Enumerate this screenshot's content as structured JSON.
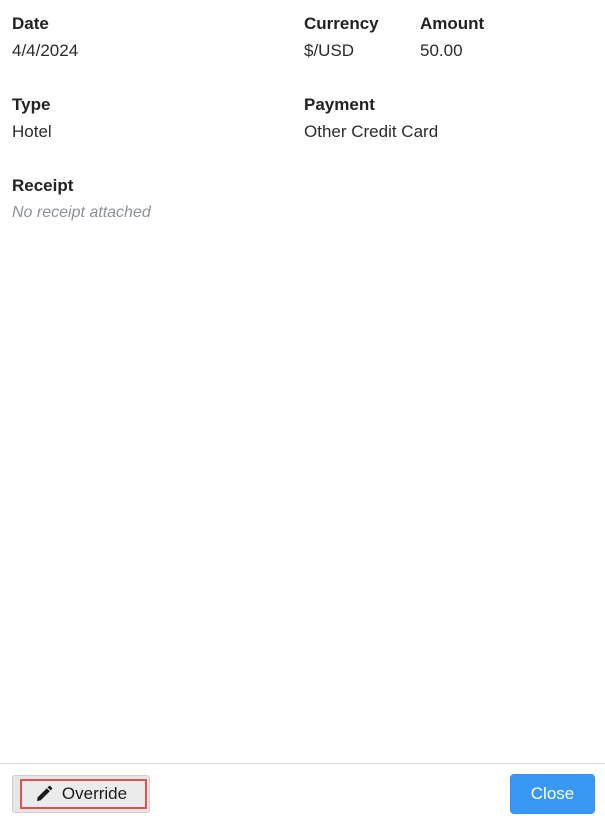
{
  "fields": {
    "date": {
      "label": "Date",
      "value": "4/4/2024"
    },
    "currency": {
      "label": "Currency",
      "value": "$/USD"
    },
    "amount": {
      "label": "Amount",
      "value": "50.00"
    },
    "type": {
      "label": "Type",
      "value": "Hotel"
    },
    "payment": {
      "label": "Payment",
      "value": "Other Credit Card"
    },
    "receipt": {
      "label": "Receipt",
      "value": "No receipt attached"
    }
  },
  "footer": {
    "override_label": "Override",
    "override_icon": "pencil-icon",
    "close_label": "Close"
  },
  "colors": {
    "close_button": "#3a98f5",
    "highlight_border": "#e05252",
    "empty_text": "#8b9099"
  }
}
